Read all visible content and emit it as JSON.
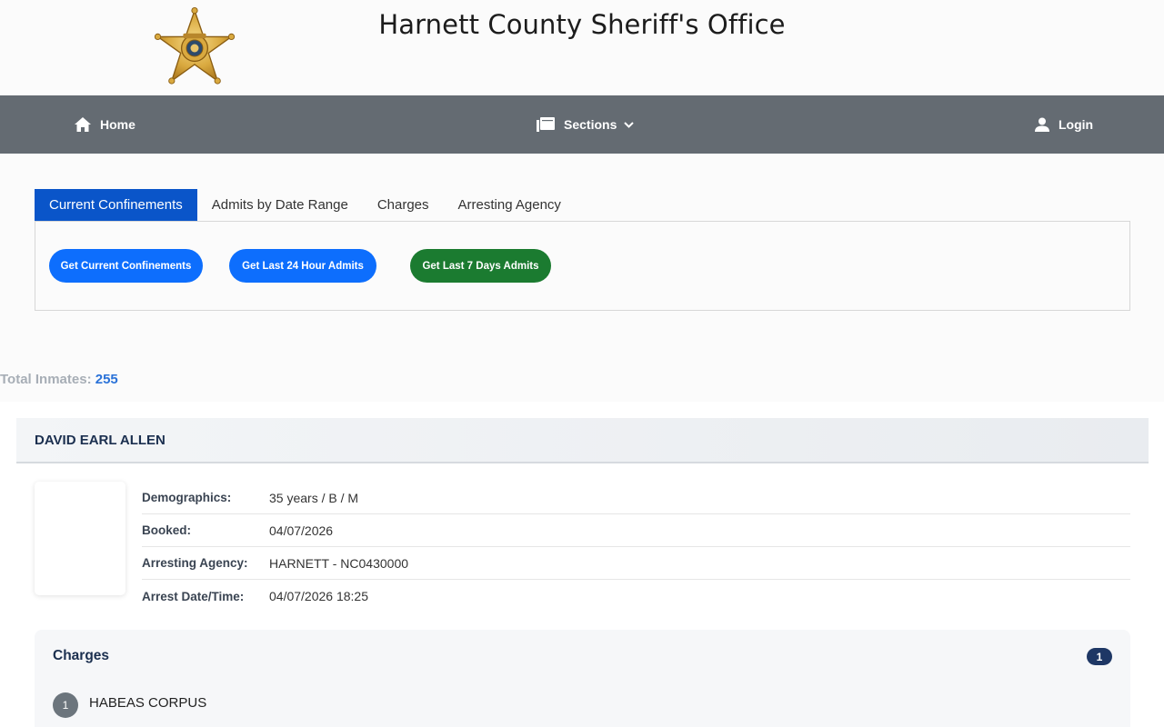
{
  "header": {
    "title": "Harnett County Sheriff's Office",
    "logo_icon": "sheriff-star-badge-icon"
  },
  "nav": {
    "home": "Home",
    "sections": "Sections",
    "login": "Login"
  },
  "tabs": [
    {
      "label": "Current Confinements",
      "active": true
    },
    {
      "label": "Admits by Date Range",
      "active": false
    },
    {
      "label": "Charges",
      "active": false
    },
    {
      "label": "Arresting Agency",
      "active": false
    }
  ],
  "actions": {
    "current": "Get Current Confinements",
    "last24": "Get Last 24 Hour Admits",
    "last7": "Get Last 7 Days Admits"
  },
  "summary": {
    "total_label": "Total Inmates:",
    "total_value": "255"
  },
  "inmate": {
    "name": "DAVID EARL ALLEN",
    "fields": [
      {
        "label": "Demographics:",
        "value": "35 years / B / M"
      },
      {
        "label": "Booked:",
        "value": "04/07/2026"
      },
      {
        "label": "Arresting Agency:",
        "value": "HARNETT - NC0430000"
      },
      {
        "label": "Arrest Date/Time:",
        "value": "04/07/2026 18:25"
      }
    ],
    "charges_title": "Charges",
    "charges_count": "1",
    "charges": [
      {
        "num": "1",
        "text": "HABEAS CORPUS"
      }
    ]
  },
  "colors": {
    "nav_bg": "#646b72",
    "tab_active": "#0a55c9",
    "pill_blue": "#0d6efd",
    "pill_green": "#1b7b30",
    "count_badge": "#1e3765"
  }
}
